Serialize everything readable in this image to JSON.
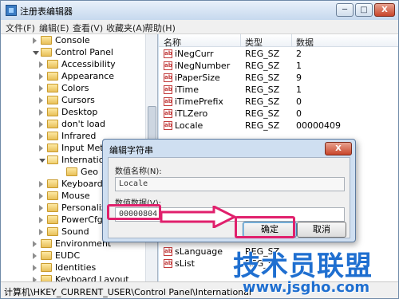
{
  "window": {
    "title": "注册表编辑器",
    "min": "─",
    "max": "□",
    "close": "X"
  },
  "menu": [
    "文件(F)",
    "编辑(E)",
    "查看(V)",
    "收藏夹(A)",
    "帮助(H)"
  ],
  "tree": [
    {
      "label": "Console",
      "expanded": false,
      "level": 0
    },
    {
      "label": "Control Panel",
      "expanded": true,
      "level": 0
    },
    {
      "label": "Accessibility",
      "expanded": false,
      "level": 1
    },
    {
      "label": "Appearance",
      "expanded": false,
      "level": 1
    },
    {
      "label": "Colors",
      "expanded": false,
      "level": 1
    },
    {
      "label": "Cursors",
      "expanded": false,
      "level": 1
    },
    {
      "label": "Desktop",
      "expanded": false,
      "level": 1
    },
    {
      "label": "don't load",
      "expanded": false,
      "level": 1
    },
    {
      "label": "Infrared",
      "expanded": false,
      "level": 1
    },
    {
      "label": "Input Met",
      "expanded": false,
      "level": 1
    },
    {
      "label": "Internation",
      "expanded": true,
      "level": 1
    },
    {
      "label": "Geo",
      "expanded": false,
      "level": 2
    },
    {
      "label": "Keyboard",
      "expanded": false,
      "level": 1
    },
    {
      "label": "Mouse",
      "expanded": false,
      "level": 1
    },
    {
      "label": "Personaliz",
      "expanded": false,
      "level": 1
    },
    {
      "label": "PowerCfg",
      "expanded": false,
      "level": 1
    },
    {
      "label": "Sound",
      "expanded": false,
      "level": 1
    },
    {
      "label": "Environment",
      "expanded": false,
      "level": 0
    },
    {
      "label": "EUDC",
      "expanded": false,
      "level": 0
    },
    {
      "label": "Identities",
      "expanded": false,
      "level": 0
    },
    {
      "label": "Keyboard Layout",
      "expanded": false,
      "level": 0
    }
  ],
  "list": {
    "headers": {
      "name": "名称",
      "type": "类型",
      "data": "数据"
    },
    "rows": [
      {
        "name": "iNegCurr",
        "type": "REG_SZ",
        "data": "2"
      },
      {
        "name": "iNegNumber",
        "type": "REG_SZ",
        "data": "1"
      },
      {
        "name": "iPaperSize",
        "type": "REG_SZ",
        "data": "9"
      },
      {
        "name": "iTime",
        "type": "REG_SZ",
        "data": "1"
      },
      {
        "name": "iTimePrefix",
        "type": "REG_SZ",
        "data": "0"
      },
      {
        "name": "iTLZero",
        "type": "REG_SZ",
        "data": "0"
      },
      {
        "name": "Locale",
        "type": "REG_SZ",
        "data": "00000409"
      }
    ],
    "rows_bottom": [
      {
        "name": "sLanguage",
        "type": "REG_SZ",
        "data": ""
      },
      {
        "name": "sList",
        "type": "REG_SZ",
        "data": ""
      }
    ]
  },
  "status": "计算机\\HKEY_CURRENT_USER\\Control Panel\\International",
  "dialog": {
    "title": "编辑字符串",
    "close": "X",
    "name_label": "数值名称(N):",
    "name_value": "Locale",
    "data_label": "数值数据(V):",
    "data_value": "00000804",
    "ok": "确定",
    "cancel": "取消"
  },
  "watermark": {
    "title": "技术员联盟",
    "url": "www.jsgho.com"
  },
  "colors": {
    "highlight": "#e0206c",
    "watermark": "#1f6fd0"
  }
}
